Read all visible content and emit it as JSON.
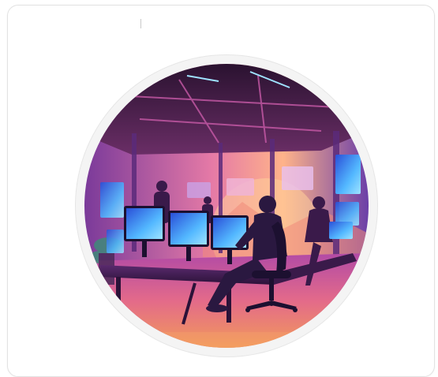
{
  "profile": {
    "avatar_icon": "office-workspace-illustration-icon",
    "colors": {
      "card_border": "#e2e2e2",
      "ring": "#f4f4f4",
      "ceiling": "#4a1f55",
      "wall_glow": "#ff9a6a",
      "screen": "#4fa7ff",
      "accent": "#b04ad8"
    }
  }
}
